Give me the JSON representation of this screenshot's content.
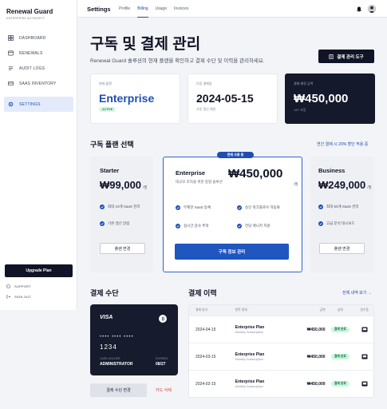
{
  "brand": {
    "name": "Renewal Guard",
    "sub": "ENTERPRISE AUTHORITY"
  },
  "sidebar": {
    "items": [
      {
        "label": "DASHBOARD",
        "icon": "grid-icon"
      },
      {
        "label": "RENEWALS",
        "icon": "refresh-icon"
      },
      {
        "label": "AUDIT LOGS",
        "icon": "list-icon"
      },
      {
        "label": "SAAS INVENTORY",
        "icon": "box-icon"
      },
      {
        "label": "SETTINGS",
        "icon": "gear-icon"
      }
    ],
    "upgrade_label": "Upgrade Plan",
    "support_label": "SUPPORT",
    "signout_label": "SIGN OUT"
  },
  "topbar": {
    "title": "Settings",
    "tabs": [
      "Profile",
      "Billing",
      "Usage",
      "Invoices"
    ],
    "active_tab": "Billing"
  },
  "header": {
    "title": "구독 및 결제 관리",
    "subtitle": "Renewal Guard 솔루션의 현재 플랜을 확인하고 결제 수단 및 이력을 관리하세요.",
    "billing_tools_label": "결제 관리 도구"
  },
  "stats": {
    "current_plan_label": "현재 플랜",
    "current_plan_value": "Enterprise",
    "current_plan_badge": "ACTIVE",
    "next_billing_label": "다음 결제일",
    "next_billing_value": "2024-05-15",
    "next_billing_note": "자동 갱신 예정",
    "amount_label": "결제 예정 금액",
    "amount_value": "₩450,000",
    "amount_note": "VAT 포함"
  },
  "plans": {
    "section_title": "구독 플랜 선택",
    "annual_link": "연간 결제 시 20% 할인 적용 중",
    "starter": {
      "name": "Starter",
      "price": "₩99,000",
      "per": "/월",
      "features": [
        "최대 10개 SaaS 관리",
        "기본 갱신 알림"
      ],
      "button": "플랜 변경"
    },
    "enterprise": {
      "badge": "현재 사용 중",
      "name": "Enterprise",
      "price": "₩450,000",
      "per": "/월",
      "desc": "대규모 조직을 위한 종합 솔루션",
      "features": [
        "무제한 SaaS 등록",
        "승인 워크플로우 자동화",
        "실시간 감사 추적",
        "전담 매니저 지원"
      ],
      "button": "구독 정보 관리"
    },
    "business": {
      "name": "Business",
      "price": "₩249,000",
      "per": "/월",
      "features": [
        "최대 50개 SaaS 관리",
        "고급 분석 대시보드"
      ],
      "button": "플랜 변경"
    }
  },
  "payment": {
    "section_title": "결제 수단",
    "card_brand": "VISA",
    "card_number_masked": "•••• •••• ••••",
    "card_last4": "1234",
    "holder_label": "CARD HOLDER",
    "holder_name": "ADMINISTRATOR",
    "expires_label": "EXPIRES",
    "expires_value": "08/27",
    "change_button": "결제 수단 변경",
    "delete_link": "카드 삭제"
  },
  "history": {
    "section_title": "결제 이력",
    "view_all": "전체 내역 보기 →",
    "columns": [
      "결제 일자",
      "항목 명세",
      "금액",
      "상태",
      "영수증"
    ],
    "rows": [
      {
        "date": "2024-04-15",
        "plan": "Enterprise Plan",
        "sub": "Monthly Subscription",
        "amount": "₩450,000",
        "status": "결제 완료"
      },
      {
        "date": "2024-03-15",
        "plan": "Enterprise Plan",
        "sub": "Monthly Subscription",
        "amount": "₩450,000",
        "status": "결제 완료"
      },
      {
        "date": "2024-02-15",
        "plan": "Enterprise Plan",
        "sub": "Monthly Subscription",
        "amount": "₩450,000",
        "status": "결제 완료"
      }
    ]
  },
  "colors": {
    "accent": "#1f56c0",
    "dark": "#101426",
    "paid_bg": "#cdf5df",
    "danger": "#d0463a"
  }
}
